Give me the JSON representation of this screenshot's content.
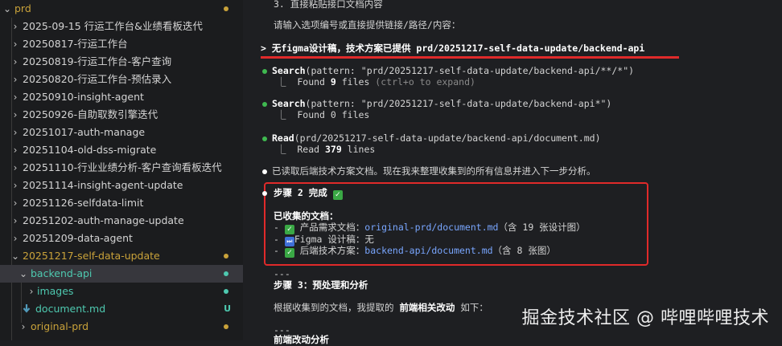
{
  "explorer": {
    "items": [
      {
        "label": "prd",
        "status_color": "#c9a23a"
      },
      {
        "label": "2025-09-15 行运工作台&业绩看板迭代"
      },
      {
        "label": "20250817-行运工作台"
      },
      {
        "label": "20250819-行运工作台-客户查询"
      },
      {
        "label": "20250820-行运工作台-预估录入"
      },
      {
        "label": "20250910-insight-agent"
      },
      {
        "label": "20250926-自助取数引擎迭代"
      },
      {
        "label": "20251017-auth-manage"
      },
      {
        "label": "20251104-old-dss-migrate"
      },
      {
        "label": "20251110-行业业绩分析-客户查询看板迭代"
      },
      {
        "label": "20251114-insight-agent-update"
      },
      {
        "label": "20251126-selfdata-limit"
      },
      {
        "label": "20251202-auth-manage-update"
      },
      {
        "label": "20251209-data-agent"
      },
      {
        "label": "20251217-self-data-update",
        "status_color": "#c9a23a"
      },
      {
        "label": "backend-api",
        "status_color": "#4ec9b0"
      },
      {
        "label": "images",
        "status_color": "#4ec9b0"
      },
      {
        "label": "document.md",
        "badge": "U"
      },
      {
        "label": "original-prd",
        "status_color": "#c9a23a"
      }
    ]
  },
  "terminal": {
    "line_step_title": "3. 直接粘贴接口文档内容",
    "line_prompt_question": "请输入选项编号或直接提供链接/路径/内容：",
    "prompt_arrow": ">",
    "prompt_text": "无figma设计稿，技术方案已提供 prd/20251217-self-data-update/backend-api",
    "tool1_name": "Search",
    "tool1_args": "(pattern: \"prd/20251217-self-data-update/backend-api/**/*\")",
    "tool1_result_prefix": "⎿  Found ",
    "tool1_count": "9",
    "tool1_result_suffix": " files",
    "tool1_hint": " (ctrl+o to expand)",
    "tool2_name": "Search",
    "tool2_args": "(pattern: \"prd/20251217-self-data-update/backend-api*\")",
    "tool2_result": "⎿  Found 0 files",
    "tool3_name": "Read",
    "tool3_args": "(prd/20251217-self-data-update/backend-api/document.md)",
    "tool3_result_prefix": "⎿  Read ",
    "tool3_count": "379",
    "tool3_result_suffix": " lines",
    "message": "已读取后端技术方案文档。现在我来整理收集到的所有信息并进入下一步分析。",
    "step2_title": "步骤 2 完成",
    "collected_title": "已收集的文档：",
    "doc1_label": "产品需求文档：",
    "doc1_path": "original-prd/document.md",
    "doc1_note": "（含 19 张设计图）",
    "doc2_label": "Figma 设计稿：无",
    "doc3_label": "后端技术方案：",
    "doc3_path": "backend-api/document.md",
    "doc3_note": "（含 8 张图）",
    "divider1": "---",
    "step3_title": "步骤 3：预处理和分析",
    "analysis_prefix": "根据收集到的文档，我提取的 ",
    "analysis_bold": "前端相关改动",
    "analysis_suffix": " 如下：",
    "divider2": "---",
    "frontend_heading": "前端改动分析",
    "bullet_color": "#3fb950",
    "check_symbol": "✓",
    "ff_symbol": "⏭"
  },
  "watermark": "掘金技术社区 @ 哔哩哔哩技术"
}
